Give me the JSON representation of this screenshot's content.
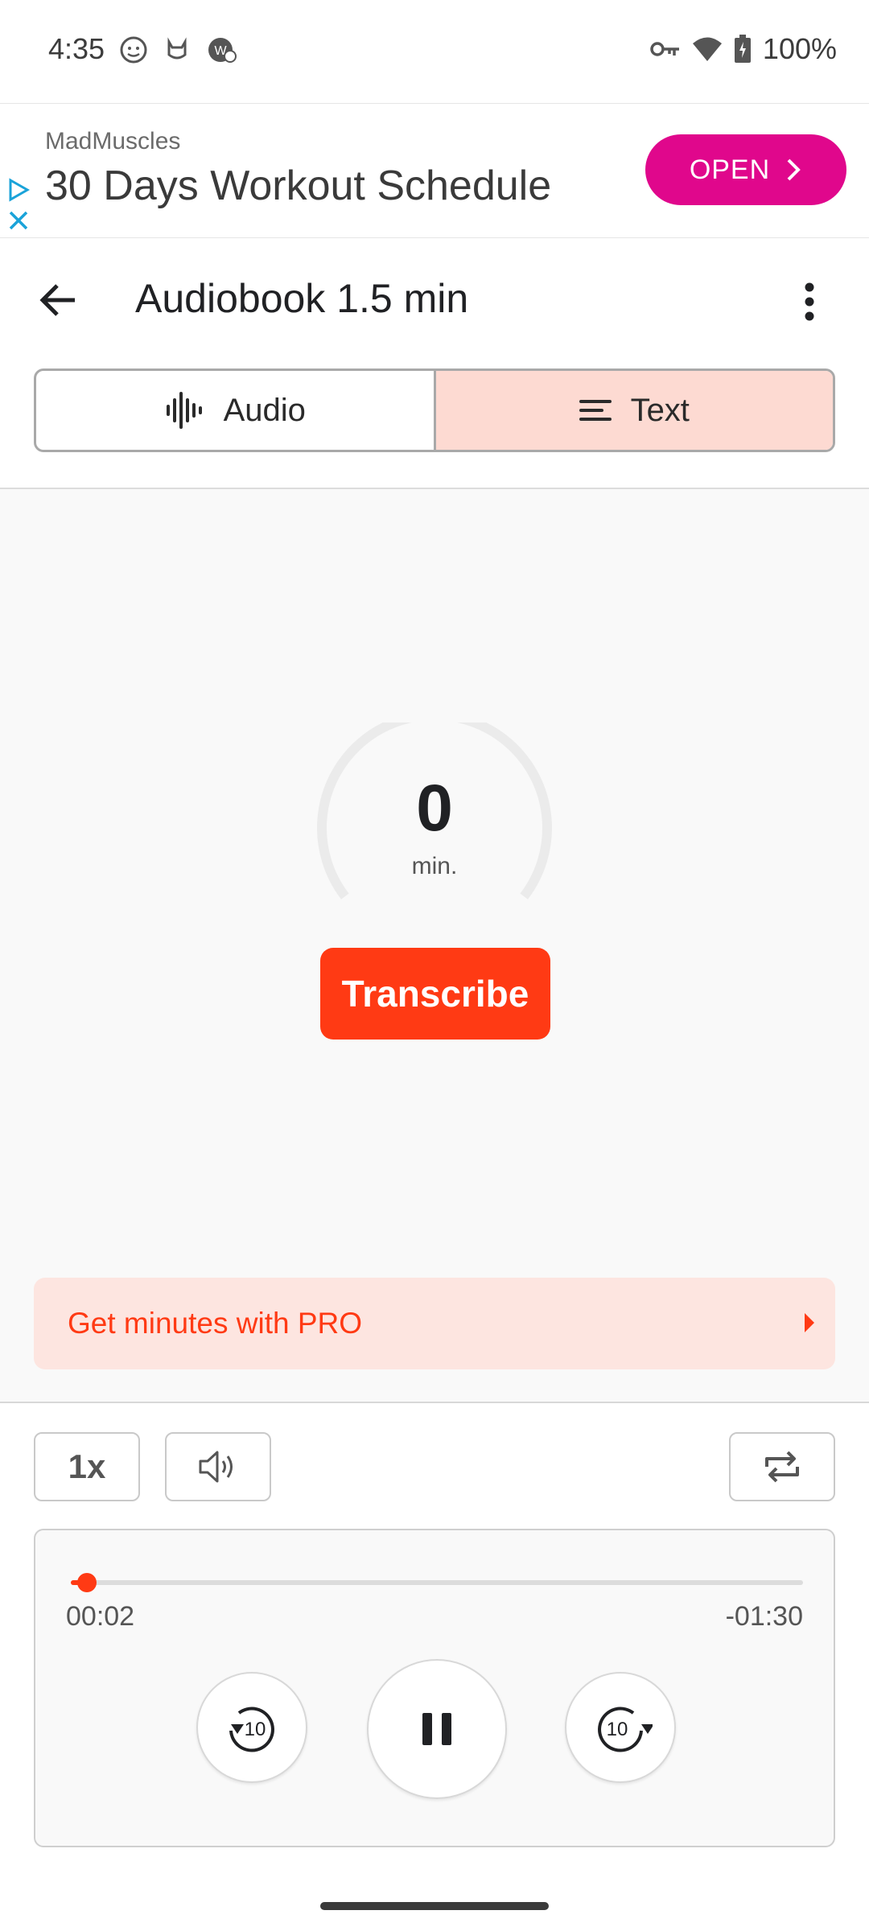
{
  "status_bar": {
    "time": "4:35",
    "battery": "100%",
    "icons_left": [
      "face-icon",
      "cat-icon",
      "app-icon"
    ],
    "icons_right": [
      "vpn-key-icon",
      "wifi-icon",
      "battery-icon"
    ]
  },
  "ad": {
    "brand": "MadMuscles",
    "title": "30 Days Workout Schedule",
    "open_label": "OPEN",
    "accent_color": "#e0078c"
  },
  "toolbar": {
    "title": "Audiobook 1.5 min"
  },
  "tabs": [
    {
      "label": "Audio",
      "icon": "waveform-icon",
      "active": false
    },
    {
      "label": "Text",
      "icon": "text-lines-icon",
      "active": true
    }
  ],
  "gauge": {
    "value": "0",
    "unit": "min.",
    "fill_fraction": 0
  },
  "transcribe_label": "Transcribe",
  "pro_banner": {
    "label": "Get minutes with PRO"
  },
  "controls": {
    "speed_label": "1x",
    "volume_icon": "volume-icon",
    "repeat_icon": "repeat-icon"
  },
  "player": {
    "elapsed": "00:02",
    "remaining": "-01:30",
    "progress_fraction": 0.022,
    "rewind_label": "10",
    "forward_label": "10"
  },
  "colors": {
    "accent": "#ff3a14",
    "tab_active_bg": "#fddad2",
    "pro_banner_bg": "#fde5e0"
  }
}
